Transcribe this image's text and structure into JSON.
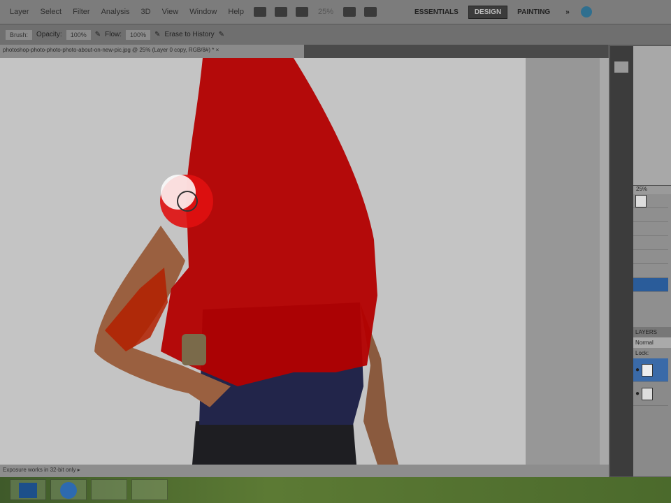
{
  "menubar": {
    "items": [
      "Layer",
      "Select",
      "Filter",
      "Analysis",
      "3D",
      "View",
      "Window",
      "Help"
    ],
    "zoom": "25%",
    "workspaces": [
      "ESSENTIALS",
      "DESIGN",
      "PAINTING"
    ],
    "active_workspace": "DESIGN",
    "more": "»"
  },
  "options": {
    "brush_label": "Brush:",
    "opacity_label": "Opacity:",
    "opacity": "100%",
    "flow_label": "Flow:",
    "flow": "100%",
    "erase_to_history": "Erase to History"
  },
  "document": {
    "tab_title": "photoshop-photo-photo-photo-about-on-new-pic.jpg @ 25% (Layer 0 copy, RGB/8#) *",
    "close": "×"
  },
  "status": {
    "text": "Exposure works in 32-bit only"
  },
  "panels": {
    "navigator_zoom": "25%",
    "layers_title": "LAYERS",
    "blend_mode": "Normal",
    "lock_label": "Lock:"
  },
  "colors": {
    "mask": "#c40000",
    "canvas": "#c4c4c4"
  }
}
